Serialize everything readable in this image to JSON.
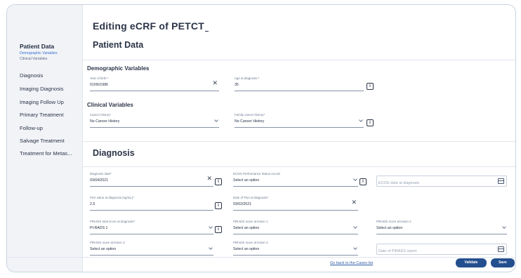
{
  "page": {
    "title": "Editing eCRF of PETCT"
  },
  "sidebar": {
    "patient_data": {
      "title": "Patient Data",
      "subs": [
        "Demographic Variables",
        "Clinical Variables"
      ]
    },
    "items": [
      "Diagnosis",
      "Imaging Diagnosis",
      "Imaging Follow Up",
      "Primary Treatment",
      "Follow-up",
      "Salvage Treatment",
      "Treatment for Metas..."
    ]
  },
  "patient_data": {
    "heading": "Patient Data",
    "demographic": {
      "title": "Demographic Variables",
      "year_of_birth": {
        "label": "Year of birth *",
        "value": "01/06/1986"
      },
      "age_at_diagnosis": {
        "label": "Age at diagnosis *",
        "value": "35"
      }
    },
    "clinical": {
      "title": "Clinical Variables",
      "cancer_history": {
        "label": "Cancer history*",
        "value": "No Cancer History"
      },
      "family_cancer_history": {
        "label": "Family cancer history*",
        "value": "No Cancer History"
      }
    }
  },
  "diagnosis": {
    "heading": "Diagnosis",
    "diagnosis_date": {
      "label": "Diagnosis date*",
      "value": "03/04/2021"
    },
    "ecog": {
      "label": "ECOG Performance Status record",
      "placeholder": "Select an option"
    },
    "ecog_date": {
      "placeholder": "ECOG date at diagnosis"
    },
    "psa_value": {
      "label": "PSA value at diagnosis (ng/mL)*",
      "value": "2.5"
    },
    "psa_date": {
      "label": "Date of PSA at diagnosis*",
      "value": "03/02/2021"
    },
    "pirads_total": {
      "label": "PIRADS total score at diagnosis*",
      "value": "PI-RADS 1"
    },
    "pirads_lesion1": {
      "label": "PIRADS score at lesion 1",
      "placeholder": "Select an option"
    },
    "pirads_lesion2": {
      "label": "PIRADS score at lesion 2",
      "placeholder": "Select an option"
    },
    "pirads_lesion3": {
      "label": "PIRADS score at lesion 3",
      "placeholder": "Select an option"
    },
    "pirads_lesion4": {
      "label": "PIRADS score at lesion 4",
      "placeholder": "Select an option"
    },
    "pirads_report_date": {
      "placeholder": "Date of PIRADS report"
    }
  },
  "footer": {
    "back_link": "Go back to the Cases list",
    "validate": "Validate",
    "save": "Save"
  },
  "icons": {
    "clear": "clear-icon",
    "dropdown": "chevron-down-icon",
    "info": "info-icon",
    "calendar": "calendar-icon"
  },
  "colors": {
    "sidebar_bg": "#f1f3f7",
    "primary_button": "#244f8f",
    "active_link": "#3b6fd0"
  }
}
